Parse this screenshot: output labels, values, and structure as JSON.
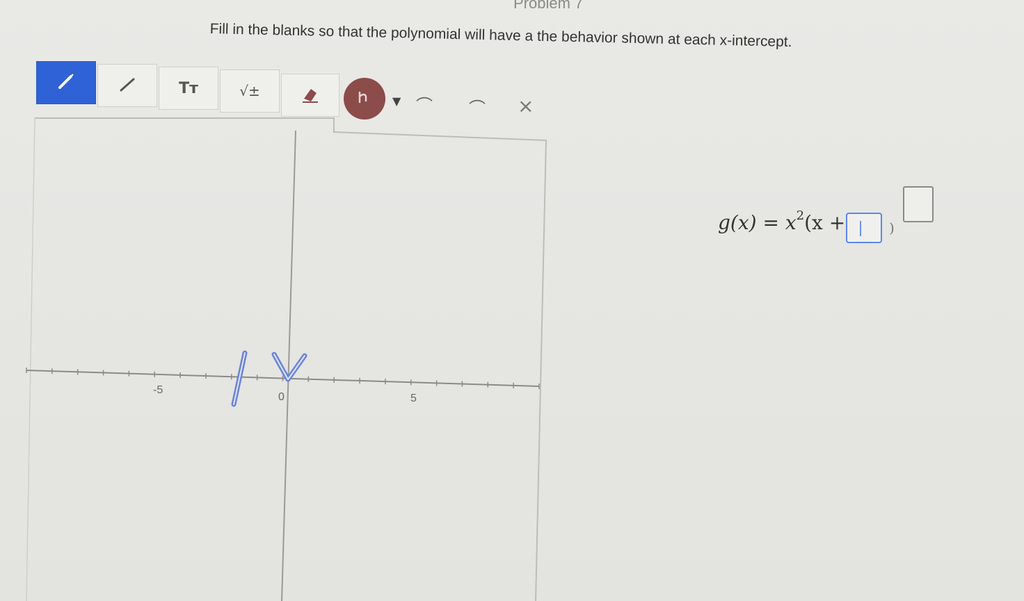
{
  "problem_header": "Problem 7",
  "instruction": "Fill in the blanks so that the polynomial will have a the behavior shown at each x-intercept.",
  "toolbar": {
    "text_tool_label": "Tт",
    "math_tool_label": "√±",
    "active_color": "#2f62d6",
    "highlight_color": "#8b4c4a",
    "items": [
      "pencil-icon",
      "line-icon",
      "text-icon",
      "sqrt-icon",
      "eraser-icon",
      "hand-icon",
      "chevron-down-icon",
      "undo-icon",
      "redo-icon",
      "close-icon"
    ]
  },
  "graph": {
    "tick_labels": [
      "-5",
      "0",
      "5"
    ],
    "x_range": [
      -10,
      10
    ],
    "sketch_color": "#6b84d8"
  },
  "equation": {
    "lhs": "g(x) = x",
    "power": "2",
    "rhs_open": "(x + ",
    "close": ")",
    "blank_value": "",
    "exponent_value": ""
  }
}
